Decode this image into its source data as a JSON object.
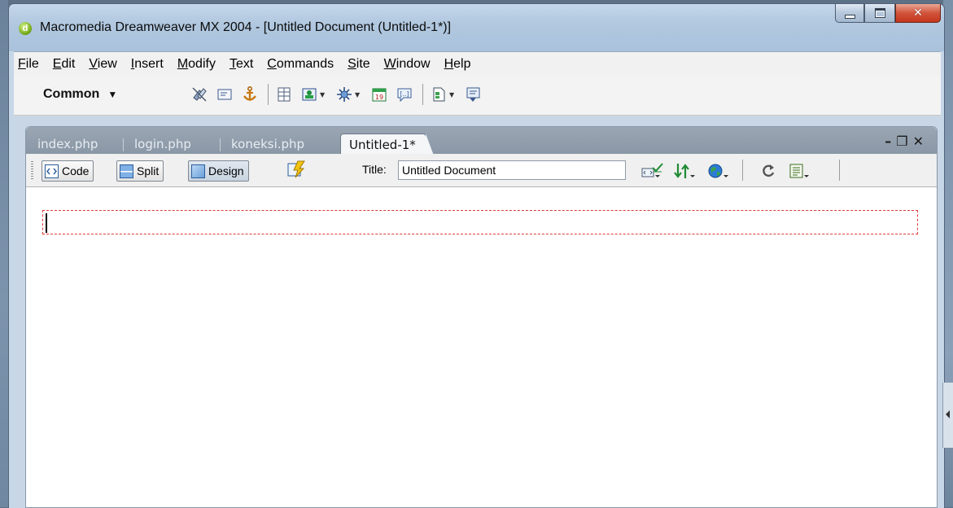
{
  "window": {
    "title": "Macromedia Dreamweaver MX 2004 - [Untitled Document (Untitled-1*)]",
    "app_icon_letter": "d"
  },
  "menu": [
    {
      "label": "File",
      "mnemonic": "F",
      "rest": "ile"
    },
    {
      "label": "Edit",
      "mnemonic": "E",
      "rest": "dit"
    },
    {
      "label": "View",
      "mnemonic": "V",
      "rest": "iew"
    },
    {
      "label": "Insert",
      "mnemonic": "I",
      "rest": "nsert"
    },
    {
      "label": "Modify",
      "mnemonic": "M",
      "rest": "odify"
    },
    {
      "label": "Text",
      "mnemonic": "T",
      "rest": "ext"
    },
    {
      "label": "Commands",
      "mnemonic": "C",
      "rest": "ommands"
    },
    {
      "label": "Site",
      "mnemonic": "S",
      "rest": "ite"
    },
    {
      "label": "Window",
      "mnemonic": "W",
      "rest": "indow"
    },
    {
      "label": "Help",
      "mnemonic": "H",
      "rest": "elp"
    }
  ],
  "insert_bar": {
    "category": "Common",
    "icons": [
      "hyperlink-icon",
      "email-link-icon",
      "named-anchor-icon",
      "table-icon",
      "image-icon",
      "media-icon",
      "date-icon",
      "comment-icon",
      "templates-icon",
      "tag-chooser-icon"
    ]
  },
  "tabs": [
    {
      "label": "index.php",
      "active": false
    },
    {
      "label": "login.php",
      "active": false
    },
    {
      "label": "koneksi.php",
      "active": false
    },
    {
      "label": "Untitled-1*",
      "active": true
    }
  ],
  "doc_toolbar": {
    "code_label": "Code",
    "split_label": "Split",
    "design_label": "Design",
    "active_view": "Design",
    "title_label": "Title:",
    "title_value": "Untitled Document"
  },
  "colors": {
    "accent_close": "#c4361d",
    "dashed_border": "#e23838"
  }
}
